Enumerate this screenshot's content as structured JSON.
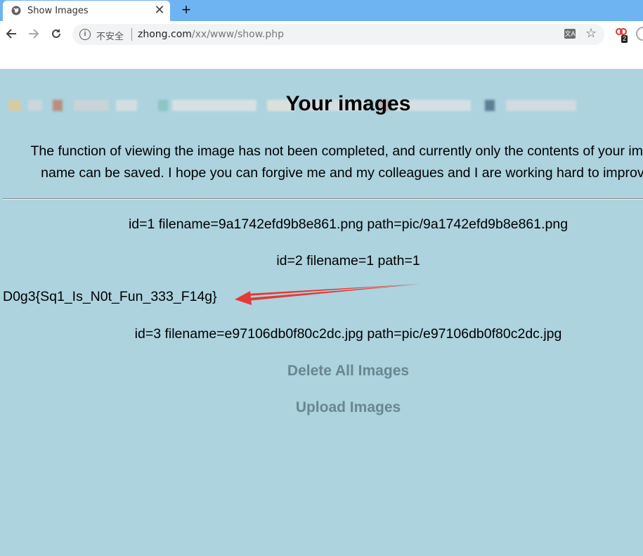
{
  "browser": {
    "tab_title": "Show Images",
    "tab_close": "✕",
    "new_tab": "+",
    "insecure_label": "不安全",
    "url_host": "zhong.com",
    "url_path": "/xx/www/show.php",
    "extension_badge": "2"
  },
  "page": {
    "title": "Your images",
    "intro_line1": "The function of viewing the image has not been completed, and currently only the contents of your image",
    "intro_line2": "name can be saved. I hope you can forgive me and my colleagues and I are working hard to improve."
  },
  "images": [
    {
      "text": "id=1 filename=9a1742efd9b8e861.png path=pic/9a1742efd9b8e861.png"
    },
    {
      "text": "id=2 filename=1 path=1"
    },
    {
      "text": "id=3 filename=e97106db0f80c2dc.jpg path=pic/e97106db0f80c2dc.jpg"
    }
  ],
  "flag_text": "D0g3{Sq1_Is_N0t_Fun_333_F14g}",
  "actions": {
    "delete_all": "Delete All Images",
    "upload": "Upload Images"
  },
  "colors": {
    "tab_strip": "#6fb4f2",
    "page_background": "#acd3de",
    "link": "#6a8690",
    "annotation_arrow": "#e53935"
  }
}
